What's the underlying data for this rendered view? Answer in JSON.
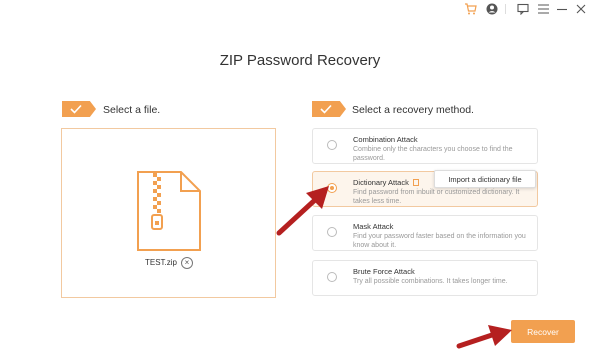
{
  "window": {
    "icons": [
      "cart-icon",
      "account-icon",
      "feedback-icon",
      "menu-icon",
      "minimize-icon",
      "close-icon"
    ]
  },
  "page": {
    "title": "ZIP Password Recovery"
  },
  "step1": {
    "label": "Select a file."
  },
  "file": {
    "name": "TEST.zip",
    "remove_glyph": "×"
  },
  "step2": {
    "label": "Select a recovery method."
  },
  "methods": [
    {
      "title": "Combination Attack",
      "desc": "Combine only the characters you choose to find the password.",
      "selected": false
    },
    {
      "title": "Dictionary Attack",
      "desc": "Find password from inbuilt or customized dictionary. It takes less time.",
      "selected": true
    },
    {
      "title": "Mask Attack",
      "desc": "Find your password faster based on the information you know about it.",
      "selected": false
    },
    {
      "title": "Brute Force Attack",
      "desc": "Try all possible combinations. It takes longer time.",
      "selected": false
    }
  ],
  "tooltip": {
    "text": "Import a dictionary file"
  },
  "actions": {
    "recover_label": "Recover"
  },
  "colors": {
    "accent": "#f2a050",
    "arrow": "#b52020",
    "panel_border": "#f2c9a0"
  }
}
